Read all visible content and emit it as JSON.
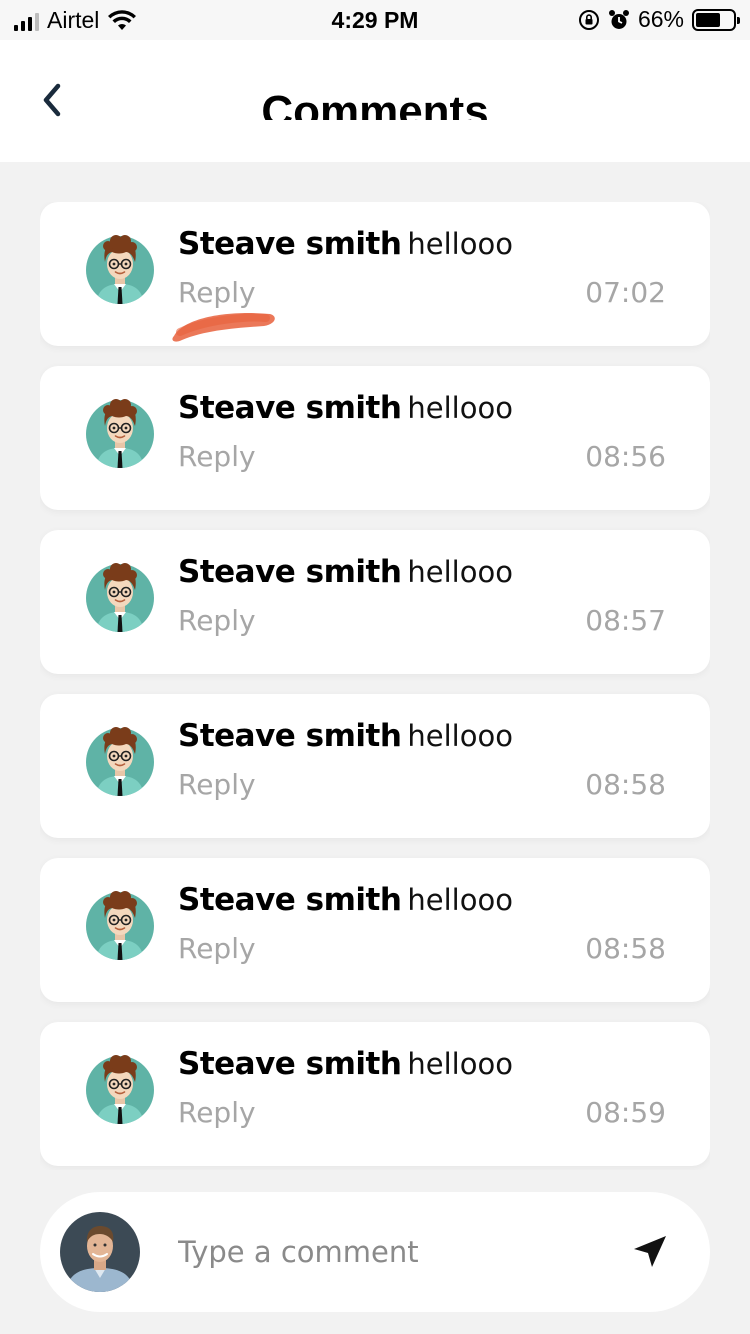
{
  "status_bar": {
    "carrier": "Airtel",
    "time": "4:29 PM",
    "battery": "66%",
    "battery_level": 0.66
  },
  "header": {
    "title": "Comments"
  },
  "comments": [
    {
      "name": "Steave smith",
      "text": "hellooo",
      "reply_label": "Reply",
      "time": "07:02"
    },
    {
      "name": "Steave smith",
      "text": "hellooo",
      "reply_label": "Reply",
      "time": "08:56"
    },
    {
      "name": "Steave smith",
      "text": "hellooo",
      "reply_label": "Reply",
      "time": "08:57"
    },
    {
      "name": "Steave smith",
      "text": "hellooo",
      "reply_label": "Reply",
      "time": "08:58"
    },
    {
      "name": "Steave smith",
      "text": "hellooo",
      "reply_label": "Reply",
      "time": "08:58"
    },
    {
      "name": "Steave smith",
      "text": "hellooo",
      "reply_label": "Reply",
      "time": "08:59"
    }
  ],
  "composer": {
    "placeholder": "Type a comment",
    "value": ""
  },
  "icons": {
    "back": "chevron-left-icon",
    "send": "send-arrow-icon",
    "wifi": "wifi-icon",
    "rotation_lock": "rotation-lock-icon",
    "alarm": "alarm-icon"
  },
  "colors": {
    "background": "#f2f2f2",
    "card": "#ffffff",
    "muted_text": "#a6a6a6",
    "avatar_teal": "#5fb3a6",
    "annotation_mark": "#e8603c"
  }
}
